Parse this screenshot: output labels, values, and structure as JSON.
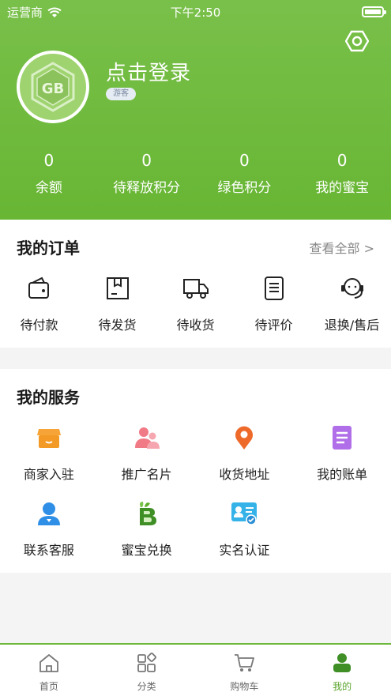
{
  "status_bar": {
    "carrier": "运营商",
    "time": "下午2:50"
  },
  "profile": {
    "login_text": "点击登录",
    "guest_badge": "游客",
    "avatar_letters": "GB"
  },
  "stats": [
    {
      "value": "0",
      "label": "余额"
    },
    {
      "value": "0",
      "label": "待释放积分"
    },
    {
      "value": "0",
      "label": "绿色积分"
    },
    {
      "value": "0",
      "label": "我的蜜宝"
    }
  ],
  "orders": {
    "title": "我的订单",
    "view_all": "查看全部 >",
    "items": [
      {
        "label": "待付款",
        "icon": "wallet-icon"
      },
      {
        "label": "待发货",
        "icon": "package-icon"
      },
      {
        "label": "待收货",
        "icon": "truck-icon"
      },
      {
        "label": "待评价",
        "icon": "document-icon"
      },
      {
        "label": "退换/售后",
        "icon": "headset-icon"
      }
    ]
  },
  "services": {
    "title": "我的服务",
    "items": [
      {
        "label": "商家入驻",
        "icon": "shop-icon"
      },
      {
        "label": "推广名片",
        "icon": "people-icon"
      },
      {
        "label": "收货地址",
        "icon": "location-pin-icon"
      },
      {
        "label": "我的账单",
        "icon": "bill-icon"
      },
      {
        "label": "联系客服",
        "icon": "customer-service-icon"
      },
      {
        "label": "蜜宝兑换",
        "icon": "exchange-b-icon"
      },
      {
        "label": "实名认证",
        "icon": "id-card-icon"
      }
    ]
  },
  "tabbar": [
    {
      "label": "首页",
      "icon": "home-icon",
      "active": false
    },
    {
      "label": "分类",
      "icon": "category-icon",
      "active": false
    },
    {
      "label": "购物车",
      "icon": "cart-icon",
      "active": false
    },
    {
      "label": "我的",
      "icon": "user-icon",
      "active": true
    }
  ],
  "colors": {
    "brand_green": "#6bb83a",
    "active_tab": "#5ba52c"
  }
}
